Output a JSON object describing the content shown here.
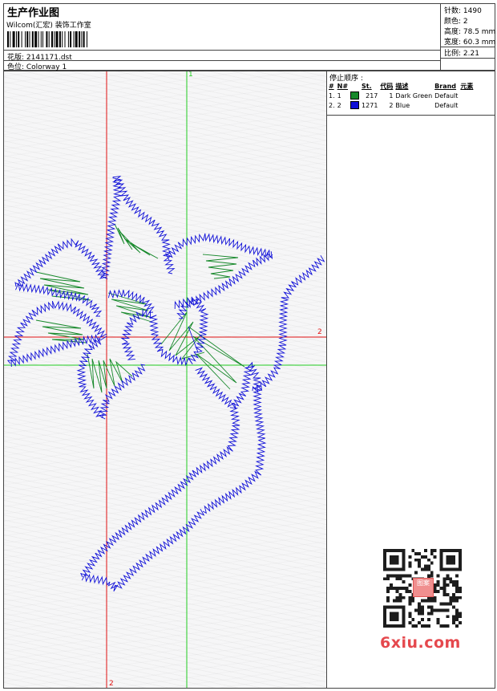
{
  "header": {
    "title": "生产作业图",
    "subtitle": "Wilcom(汇宏) 装饰工作室",
    "design_file": "花版: 2141171.dst",
    "colorway": "色位: Colorway 1"
  },
  "stats": {
    "stitches": "针数: 1490",
    "colors": "颜色: 2",
    "height": "高度: 78.5 mm",
    "width": "宽度: 60.3 mm",
    "scale": "比例: 2.21"
  },
  "stop_sequence": {
    "title": "停止顺序 :",
    "columns": [
      "#",
      "N#",
      "St.",
      "代码",
      "描述",
      "Brand",
      "元素"
    ],
    "rows": [
      {
        "index": "1.",
        "needle": "1",
        "color": "#16882a",
        "stitches": "217",
        "code": "1",
        "description": "Dark Green",
        "brand": "Default"
      },
      {
        "index": "2.",
        "needle": "2",
        "color": "#1010d8",
        "stitches": "1271",
        "code": "2",
        "description": "Blue",
        "brand": "Default"
      }
    ]
  },
  "axes": {
    "green_v": "1",
    "red_h": "2",
    "red_v": "2"
  },
  "colors": {
    "axis_green": "#22cc22",
    "axis_red": "#e01010",
    "thread_green": "#16882a",
    "thread_blue": "#1010d8"
  },
  "watermark": {
    "site": "6xiu.com",
    "stamp": "图案"
  }
}
